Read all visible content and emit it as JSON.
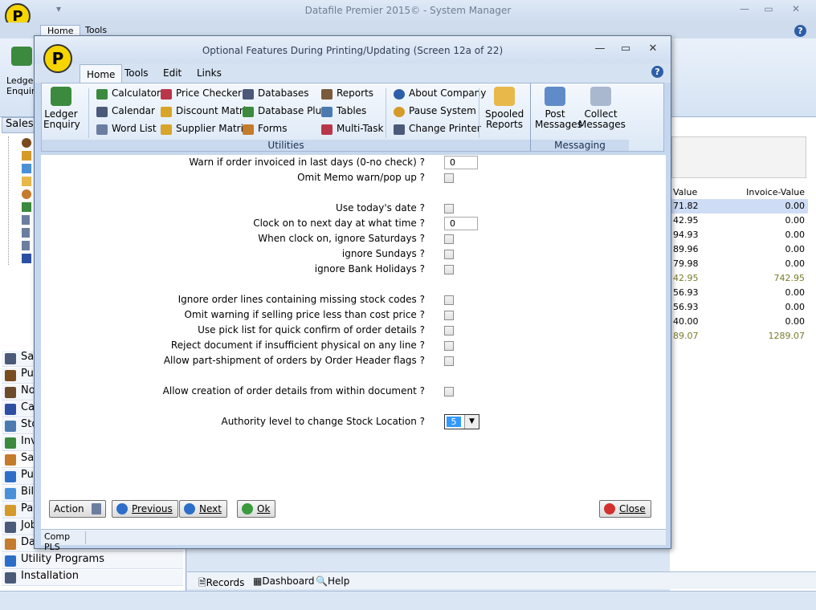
{
  "main_window": {
    "title": "Datafile  Premier 2015©  - System Manager",
    "logo_letter": "P",
    "tabs": [
      "Home",
      "Tools"
    ],
    "ledger_enquiry_label": "Ledger Enquiry",
    "sales_header": "Sales",
    "nav_items": [
      {
        "label": "Sa",
        "icon": "sales-ledger-icon"
      },
      {
        "label": "Pu",
        "icon": "purchase-ledger-icon"
      },
      {
        "label": "No",
        "icon": "nominal-ledger-icon"
      },
      {
        "label": "Ca",
        "icon": "cash-book-icon"
      },
      {
        "label": "Sto",
        "icon": "stock-icon"
      },
      {
        "label": "Inv",
        "icon": "invoicing-icon"
      },
      {
        "label": "Sa",
        "icon": "sales-order-icon"
      },
      {
        "label": "Pu",
        "icon": "purchase-order-icon"
      },
      {
        "label": "Bill",
        "icon": "bill-icon"
      },
      {
        "label": "Pa",
        "icon": "payroll-icon"
      },
      {
        "label": "Job",
        "icon": "job-icon"
      },
      {
        "label": "Da",
        "icon": "data-icon"
      },
      {
        "label": "Utility Programs",
        "icon": "utility-icon"
      },
      {
        "label": "Installation",
        "icon": "installation-icon"
      }
    ],
    "grid_headers": {
      "value": "Value",
      "invoice_value": "Invoice-Value"
    },
    "grid_rows": [
      {
        "value": "71.82",
        "invoice": "0.00",
        "highlight": true,
        "olive": false
      },
      {
        "value": "42.95",
        "invoice": "0.00",
        "highlight": false,
        "olive": false
      },
      {
        "value": "94.93",
        "invoice": "0.00",
        "highlight": false,
        "olive": false
      },
      {
        "value": "89.96",
        "invoice": "0.00",
        "highlight": false,
        "olive": false
      },
      {
        "value": "79.98",
        "invoice": "0.00",
        "highlight": false,
        "olive": false
      },
      {
        "value": "42.95",
        "invoice": "742.95",
        "highlight": false,
        "olive": true
      },
      {
        "value": "56.93",
        "invoice": "0.00",
        "highlight": false,
        "olive": false
      },
      {
        "value": "56.93",
        "invoice": "0.00",
        "highlight": false,
        "olive": false
      },
      {
        "value": "40.00",
        "invoice": "0.00",
        "highlight": false,
        "olive": false
      },
      {
        "value": "89.07",
        "invoice": "1289.07",
        "highlight": false,
        "olive": true
      }
    ],
    "bottom_tabs": {
      "records": "Records",
      "dashboard": "Dashboard",
      "help": "Help"
    }
  },
  "dialog": {
    "title": "Optional Features During Printing/Updating  (Screen 12a of 22)",
    "tabs": {
      "home": "Home",
      "tools": "Tools",
      "edit": "Edit",
      "links": "Links"
    },
    "ribbon": {
      "ledger_enquiry": "Ledger Enquiry",
      "utilities_items": {
        "calculator": "Calculator",
        "calendar": "Calendar",
        "word_list": "Word List",
        "price_checker": "Price Checker",
        "discount_matrix": "Discount Matrix",
        "supplier_matrix": "Supplier Matrix",
        "databases": "Databases",
        "database_plus": "Database Plus",
        "forms": "Forms",
        "reports": "Reports",
        "tables": "Tables",
        "multi_task": "Multi-Task",
        "about_company": "About Company",
        "pause_system": "Pause System",
        "change_printer": "Change Printer"
      },
      "spooled_reports": "Spooled Reports",
      "post_messages": "Post Messages",
      "collect_messages": "Collect Messages",
      "group_utilities": "Utilities",
      "group_messaging": "Messaging"
    },
    "form": {
      "warn_invoiced_label": "Warn if order invoiced in last days (0-no check) ?",
      "warn_invoiced_value": "0",
      "omit_memo_label": "Omit Memo warn/pop up ?",
      "use_today_label": "Use today's date ?",
      "clock_on_label": "Clock on to next day at what time ?",
      "clock_on_value": "0",
      "ignore_saturdays_label": "When clock on, ignore Saturdays ?",
      "ignore_sundays_label": "ignore Sundays ?",
      "ignore_bank_holidays_label": "ignore Bank Holidays ?",
      "ignore_missing_stock_label": "Ignore order lines containing missing stock codes ?",
      "omit_price_warning_label": "Omit warning if selling price less than cost price ?",
      "pick_list_label": "Use pick list for quick confirm of order details ?",
      "reject_insufficient_label": "Reject document if insufficient physical on any line ?",
      "part_shipment_label": "Allow part-shipment of orders by Order Header flags ?",
      "allow_creation_label": "Allow creation of order details from within document ?",
      "authority_level_label": "Authority level to change Stock Location ?",
      "authority_level_value": "5"
    },
    "buttons": {
      "action": "Action",
      "previous": "Previous",
      "next": "Next",
      "ok": "Ok",
      "close": "Close"
    },
    "status": "Comp PLS"
  },
  "colors": {
    "accent_blue": "#1f5fbf",
    "olive_text": "#7a7a2e",
    "highlight_row": "#cfdcf5"
  }
}
